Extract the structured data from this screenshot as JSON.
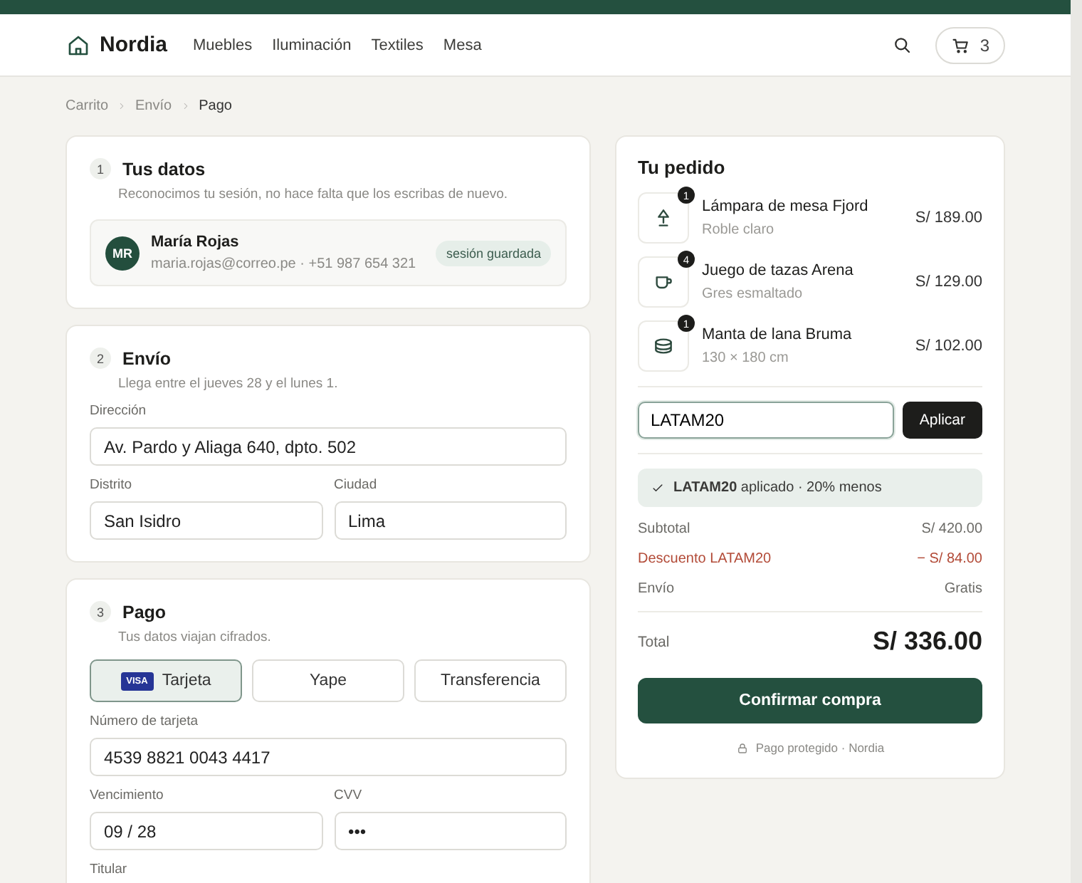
{
  "header": {
    "brand": "Nordia",
    "nav": [
      "Muebles",
      "Iluminación",
      "Textiles",
      "Mesa"
    ],
    "cart_count": "3"
  },
  "breadcrumb": [
    {
      "label": "Carrito",
      "selected": false
    },
    {
      "label": "Envío",
      "selected": false
    },
    {
      "label": "Pago",
      "selected": true
    }
  ],
  "steps": [
    {
      "number": "1",
      "title": "Tus datos",
      "subtitle": "Reconocimos tu sesión, no hace falta que los escribas de nuevo.",
      "profile": {
        "initials": "MR",
        "name": "María Rojas",
        "contact": "maria.rojas@correo.pe · +51 987 654 321",
        "badge": "sesión guardada"
      }
    },
    {
      "number": "2",
      "title": "Envío",
      "subtitle": "Llega entre el jueves 28 y el lunes 1.",
      "field_rows": [
        [
          {
            "label": "Dirección",
            "value": "Av. Pardo y Aliaga 640, dpto. 502"
          }
        ],
        [
          {
            "label": "Distrito",
            "value": "San Isidro"
          },
          {
            "label": "Ciudad",
            "value": "Lima"
          }
        ]
      ]
    },
    {
      "number": "3",
      "title": "Pago",
      "subtitle": "Tus datos viajan cifrados.",
      "methods": [
        {
          "label": "Tarjeta",
          "logo": "VISA",
          "selected": true
        },
        {
          "label": "Yape",
          "selected": false
        },
        {
          "label": "Transferencia",
          "selected": false
        }
      ],
      "field_rows": [
        [
          {
            "label": "Número de tarjeta",
            "value": "4539 8821 0043 4417"
          }
        ],
        [
          {
            "label": "Vencimiento",
            "value": "09 / 28"
          },
          {
            "label": "CVV",
            "value": "•••"
          }
        ],
        [
          {
            "label": "Titular"
          }
        ]
      ]
    }
  ],
  "order": {
    "title": "Tu pedido",
    "items": [
      {
        "kind": "lamp",
        "qty": "1",
        "name": "Lámpara de mesa Fjord",
        "variant": "Roble claro",
        "price": "S/ 189.00"
      },
      {
        "kind": "cup",
        "qty": "4",
        "name": "Juego de tazas Arena",
        "variant": "Gres esmaltado",
        "price": "S/ 129.00"
      },
      {
        "kind": "blanket",
        "qty": "1",
        "name": "Manta de lana Bruma",
        "variant": "130 × 180 cm",
        "price": "S/ 102.00"
      }
    ],
    "coupon": {
      "value": "LATAM20",
      "button": "Aplicar"
    },
    "notice": "**LATAM20** aplicado · 20% menos",
    "summary": [
      {
        "kind": "normal",
        "label": "Subtotal",
        "value": "S/ 420.00"
      },
      {
        "kind": "discount",
        "label": "Descuento LATAM20",
        "value": "− S/ 84.00"
      },
      {
        "kind": "normal",
        "label": "Envío",
        "value": "Gratis"
      }
    ],
    "total": {
      "label": "Total",
      "value": "S/ 336.00"
    },
    "confirm": "Confirmar compra",
    "secure_note": "Pago protegido · Nordia"
  }
}
